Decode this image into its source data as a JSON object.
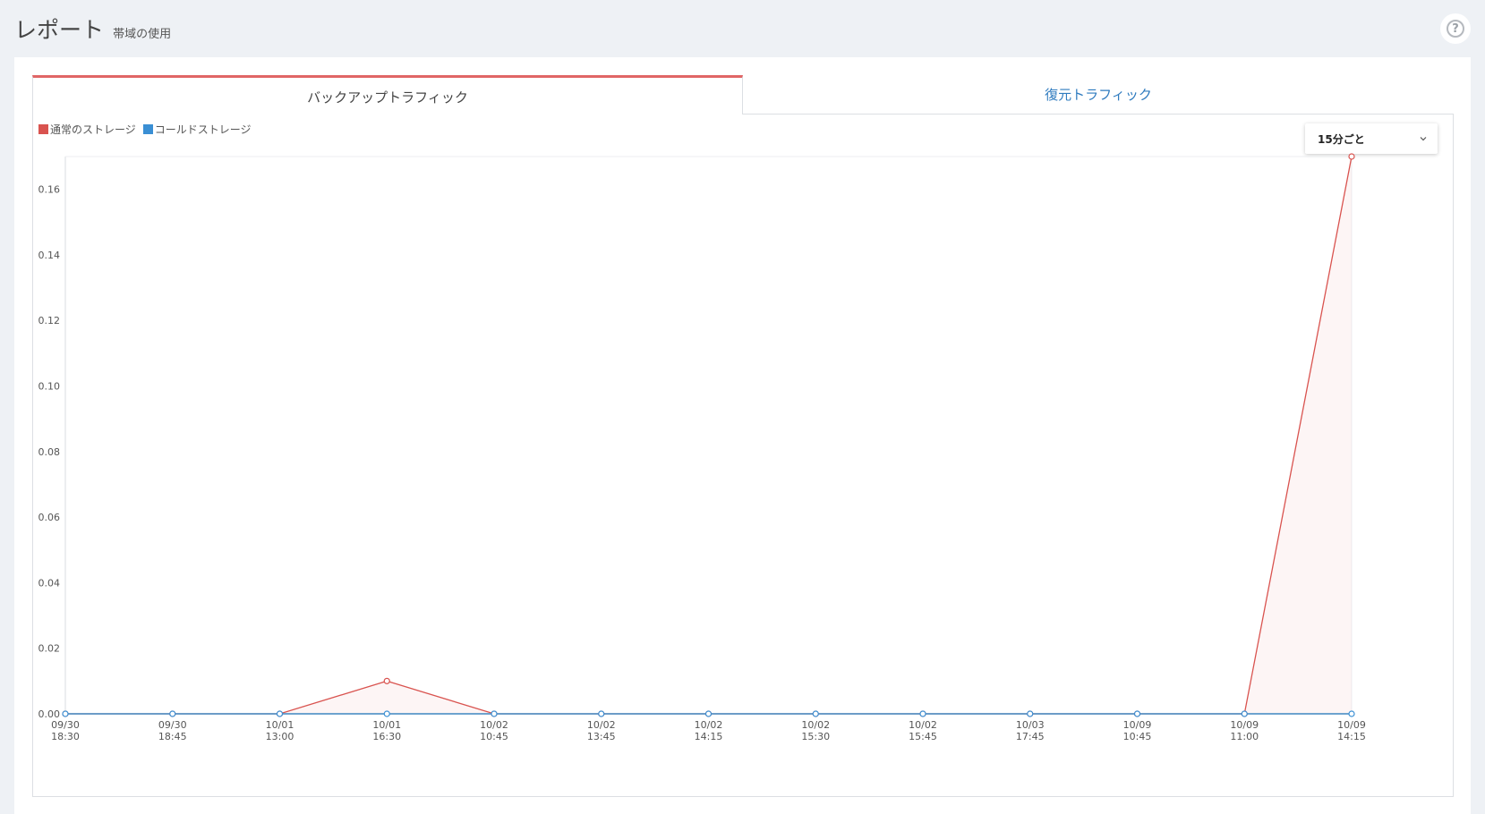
{
  "page": {
    "title": "レポート",
    "subtitle": "帯域の使用",
    "help_icon": "question-circle-icon",
    "help_glyph": "?"
  },
  "tabs": [
    {
      "label": "バックアップトラフィック",
      "active": true
    },
    {
      "label": "復元トラフィック",
      "active": false
    }
  ],
  "period_select": {
    "value": "15分ごと",
    "icon": "chevron-down-icon"
  },
  "colors": {
    "accent_tab": "#e06666",
    "series_normal": "#d9534f",
    "series_cold": "#3a8fd4",
    "link": "#2f7bbf"
  },
  "chart_data": {
    "type": "area",
    "title": "",
    "xlabel": "",
    "ylabel": "",
    "ylim": [
      0,
      0.17
    ],
    "yticks": [
      "0.00",
      "0.02",
      "0.04",
      "0.06",
      "0.08",
      "0.10",
      "0.12",
      "0.14",
      "0.16"
    ],
    "x": [
      [
        "09/30",
        "18:30"
      ],
      [
        "09/30",
        "18:45"
      ],
      [
        "10/01",
        "13:00"
      ],
      [
        "10/01",
        "16:30"
      ],
      [
        "10/02",
        "10:45"
      ],
      [
        "10/02",
        "13:45"
      ],
      [
        "10/02",
        "14:15"
      ],
      [
        "10/02",
        "15:30"
      ],
      [
        "10/02",
        "15:45"
      ],
      [
        "10/03",
        "17:45"
      ],
      [
        "10/09",
        "10:45"
      ],
      [
        "10/09",
        "11:00"
      ],
      [
        "10/09",
        "14:15"
      ]
    ],
    "series": [
      {
        "name": "通常のストレージ",
        "color": "#d9534f",
        "values": [
          0,
          0,
          0,
          0.01,
          0,
          0,
          0,
          0,
          0,
          0,
          0,
          0,
          0.17
        ]
      },
      {
        "name": "コールドストレージ",
        "color": "#3a8fd4",
        "values": [
          0,
          0,
          0,
          0,
          0,
          0,
          0,
          0,
          0,
          0,
          0,
          0,
          0
        ]
      }
    ],
    "grid": false,
    "legend": "top-left"
  }
}
